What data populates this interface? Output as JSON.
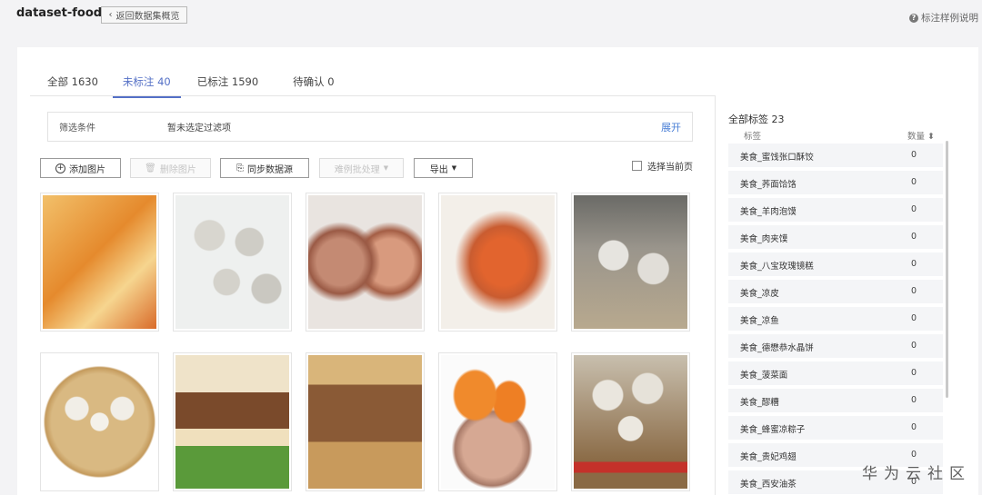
{
  "header": {
    "dataset_name": "dataset-food",
    "back_label": "返回数据集概览",
    "help_label": "标注样例说明"
  },
  "tabs": [
    {
      "label": "全部 1630"
    },
    {
      "label": "未标注 40"
    },
    {
      "label": "已标注 1590"
    },
    {
      "label": "待确认 0"
    }
  ],
  "filter": {
    "label": "筛选条件",
    "value": "暂未选定过滤项",
    "expand_label": "展开"
  },
  "toolbar": {
    "add_label": "添加图片",
    "delete_label": "删除图片",
    "sync_label": "同步数据源",
    "batch_label": "难例批处理",
    "export_label": "导出",
    "select_page_label": "选择当前页"
  },
  "images": [
    {
      "name": "food-image-1",
      "color": "#e8a24a"
    },
    {
      "name": "food-image-2",
      "color": "#b5b5b0"
    },
    {
      "name": "food-image-3",
      "color": "#b67a62"
    },
    {
      "name": "food-image-4",
      "color": "#c96a3d"
    },
    {
      "name": "food-image-5",
      "color": "#a8a49c"
    },
    {
      "name": "food-image-6",
      "color": "#d9c39a"
    },
    {
      "name": "food-image-7",
      "color": "#9c6a3f"
    },
    {
      "name": "food-image-8",
      "color": "#8d5a34"
    },
    {
      "name": "food-image-9",
      "color": "#d88844"
    },
    {
      "name": "food-image-10",
      "color": "#c9b89a"
    }
  ],
  "labels_panel": {
    "title": "全部标签 23",
    "col_label": "标签",
    "col_count": "数量 ⬍",
    "items": [
      {
        "name": "美食_蜜饯张口酥饺",
        "count": "0"
      },
      {
        "name": "美食_荞面饸饹",
        "count": "0"
      },
      {
        "name": "美食_羊肉泡馍",
        "count": "0"
      },
      {
        "name": "美食_肉夹馍",
        "count": "0"
      },
      {
        "name": "美食_八宝玫瑰镜糕",
        "count": "0"
      },
      {
        "name": "美食_凉皮",
        "count": "0"
      },
      {
        "name": "美食_凉鱼",
        "count": "0"
      },
      {
        "name": "美食_德懋恭水晶饼",
        "count": "0"
      },
      {
        "name": "美食_菠菜面",
        "count": "0"
      },
      {
        "name": "美食_醪糟",
        "count": "0"
      },
      {
        "name": "美食_蜂蜜凉粽子",
        "count": "0"
      },
      {
        "name": "美食_贵妃鸡翅",
        "count": "0"
      },
      {
        "name": "美食_西安油茶",
        "count": "0"
      }
    ]
  },
  "watermark": "华为云社区"
}
